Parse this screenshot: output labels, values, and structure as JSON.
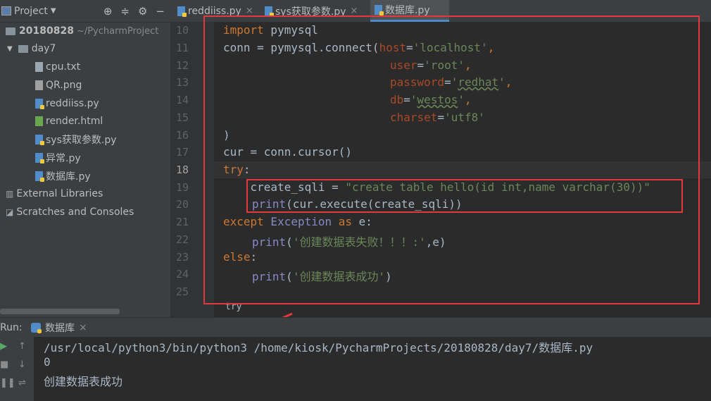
{
  "project": {
    "title": "Project",
    "root_name": "20180828",
    "root_path": "~/PycharmProject",
    "folder": "day7",
    "files": [
      "cpu.txt",
      "QR.png",
      "reddiiss.py",
      "render.html",
      "sys获取参数.py",
      "异常.py",
      "数据库.py"
    ],
    "external_libraries": "External Libraries",
    "scratches": "Scratches and Consoles"
  },
  "tabs": [
    {
      "label": "reddiiss.py"
    },
    {
      "label": "sys获取参数.py"
    },
    {
      "label": "数据库.py"
    }
  ],
  "editor": {
    "line_numbers": [
      "10",
      "11",
      "12",
      "13",
      "14",
      "15",
      "16",
      "17",
      "18",
      "19",
      "20",
      "21",
      "22",
      "23",
      "24",
      "25"
    ],
    "code": {
      "l10_kw": "import",
      "l10_rest": " pymysql",
      "l11_a": "conn = pymysql.connect(",
      "l11_p": "host",
      "l11_eq": "=",
      "l11_s": "'localhost'",
      "l11_c": ",",
      "l12_p": "user",
      "l12_eq": "=",
      "l12_s": "'root'",
      "l12_c": ",",
      "l13_p": "password",
      "l13_eq": "=",
      "l13_s1": "'",
      "l13_s2": "redhat",
      "l13_s3": "'",
      "l13_c": ",",
      "l14_p": "db",
      "l14_eq": "=",
      "l14_s1": "'",
      "l14_s2": "westos",
      "l14_s3": "'",
      "l14_c": ",",
      "l15_p": "charset",
      "l15_eq": "=",
      "l15_s": "'utf8'",
      "l16": ")",
      "l17": "cur = conn.cursor()",
      "l18_kw": "try",
      "l18_rest": ":",
      "l19_a": "    create_sqli = ",
      "l19_s": "\"create table hello(id int,name varchar(30))\"",
      "l20_b": "print",
      "l20_rest": "(cur.execute(create_sqli))",
      "l21_kw1": "except",
      "l21_bi": " Exception ",
      "l21_kw2": "as",
      "l21_rest": " e:",
      "l22_b": "print",
      "l22_a": "(",
      "l22_s": "'创建数据表失败！！！:'",
      "l22_rest": ",e)",
      "l23_kw": "else",
      "l23_rest": ":",
      "l24_b": "print",
      "l24_a": "(",
      "l24_s": "'创建数据表成功'",
      "l24_rest": ")"
    },
    "breadcrumb": "try"
  },
  "run": {
    "label": "Run:",
    "tab": "数据库",
    "command": "/usr/local/python3/bin/python3 /home/kiosk/PycharmProjects/20180828/day7/数据库.py",
    "output": [
      "0",
      "创建数据表成功"
    ]
  },
  "colors": {
    "annotation": "#e0393e",
    "keyword": "#cc7832",
    "string": "#6a8759",
    "param": "#aa4926"
  }
}
